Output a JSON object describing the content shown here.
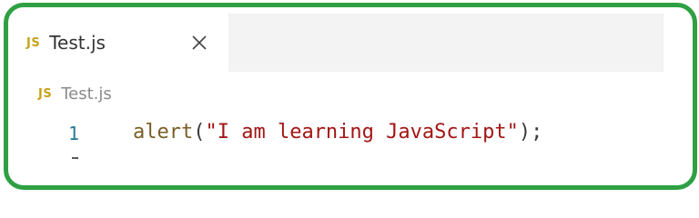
{
  "colors": {
    "frame_border": "#2ea043",
    "js_icon": "#c7a218",
    "function_name": "#795e26",
    "string_literal": "#a31515",
    "line_number": "#237893"
  },
  "tab": {
    "icon_text": "JS",
    "label": "Test.js",
    "close_icon": "close-icon"
  },
  "breadcrumb": {
    "icon_text": "JS",
    "label": "Test.js"
  },
  "editor": {
    "line_number": "1",
    "tokens": {
      "function": "alert",
      "open_paren": "(",
      "string": "\"I am learning JavaScript\"",
      "close": ");"
    }
  }
}
